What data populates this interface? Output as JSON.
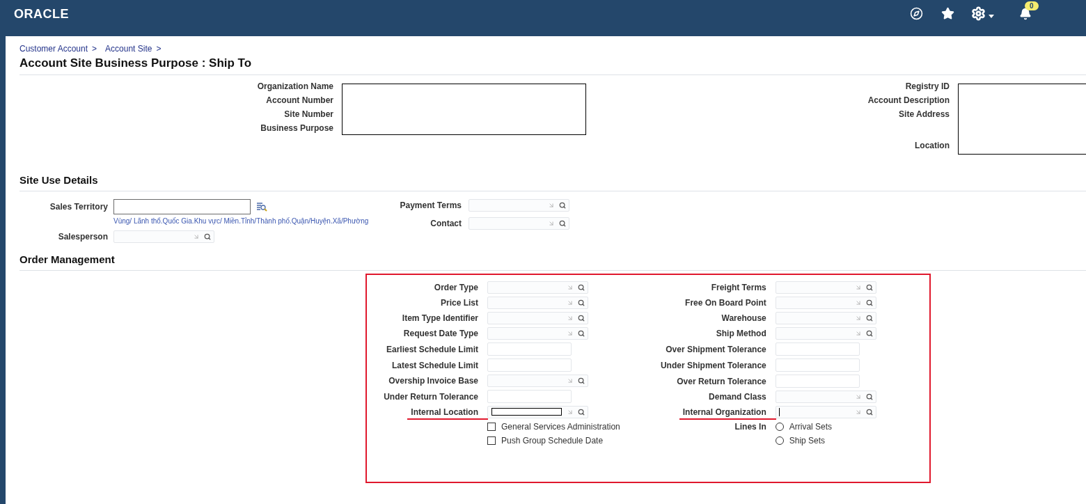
{
  "header": {
    "logo": "ORACLE",
    "notification_count": "0"
  },
  "breadcrumbs": [
    {
      "label": "Customer Account",
      "separator": ">"
    },
    {
      "label": "Account Site",
      "separator": ">"
    }
  ],
  "title": "Account Site Business Purpose : Ship To",
  "info": {
    "left": {
      "labels": [
        "Organization Name",
        "Account Number",
        "Site Number",
        "Business Purpose"
      ],
      "redacted": true
    },
    "right": {
      "labels": [
        "Registry ID",
        "Account Description",
        "Site Address",
        "Location"
      ],
      "redacted": true
    }
  },
  "site_use": {
    "heading": "Site Use Details",
    "left": [
      {
        "label": "Sales Territory",
        "kind": "search-text",
        "hint": "Vùng/ Lãnh thổ.Quốc Gia.Khu vực/ Miền.Tỉnh/Thành phố.Quận/Huyện.Xã/Phường"
      },
      {
        "label": "Salesperson",
        "kind": "lov"
      }
    ],
    "right": [
      {
        "label": "Payment Terms",
        "kind": "lov"
      },
      {
        "label": "Contact",
        "kind": "lov"
      }
    ]
  },
  "order_management": {
    "heading": "Order Management",
    "highlighted": true,
    "left": [
      {
        "label": "Order Type",
        "kind": "lov",
        "underlined": false
      },
      {
        "label": "Price List",
        "kind": "lov",
        "underlined": false
      },
      {
        "label": "Item Type Identifier",
        "kind": "lov",
        "underlined": false
      },
      {
        "label": "Request Date Type",
        "kind": "lov",
        "underlined": false
      },
      {
        "label": "Earliest Schedule Limit",
        "kind": "text",
        "underlined": false
      },
      {
        "label": "Latest Schedule Limit",
        "kind": "text",
        "underlined": false
      },
      {
        "label": "Overship Invoice Base",
        "kind": "lov",
        "underlined": false
      },
      {
        "label": "Under Return Tolerance",
        "kind": "text",
        "underlined": false
      },
      {
        "label": "Internal Location",
        "kind": "lov",
        "underlined": true,
        "redacted": true
      }
    ],
    "checkboxes": [
      {
        "label": "General Services Administration",
        "checked": false
      },
      {
        "label": "Push Group Schedule Date",
        "checked": false
      }
    ],
    "right": [
      {
        "label": "Freight Terms",
        "kind": "lov",
        "underlined": false
      },
      {
        "label": "Free On Board Point",
        "kind": "lov",
        "underlined": false
      },
      {
        "label": "Warehouse",
        "kind": "lov",
        "underlined": false
      },
      {
        "label": "Ship Method",
        "kind": "lov",
        "underlined": false
      },
      {
        "label": "Over Shipment Tolerance",
        "kind": "text",
        "underlined": false
      },
      {
        "label": "Under Shipment Tolerance",
        "kind": "text",
        "underlined": false
      },
      {
        "label": "Over Return Tolerance",
        "kind": "text",
        "underlined": false
      },
      {
        "label": "Demand Class",
        "kind": "lov",
        "underlined": false
      },
      {
        "label": "Internal Organization",
        "kind": "lov",
        "underlined": true,
        "focused": true
      }
    ],
    "lines_in": {
      "label": "Lines In",
      "options": [
        {
          "label": "Arrival Sets",
          "selected": false
        },
        {
          "label": "Ship Sets",
          "selected": false
        }
      ]
    }
  }
}
